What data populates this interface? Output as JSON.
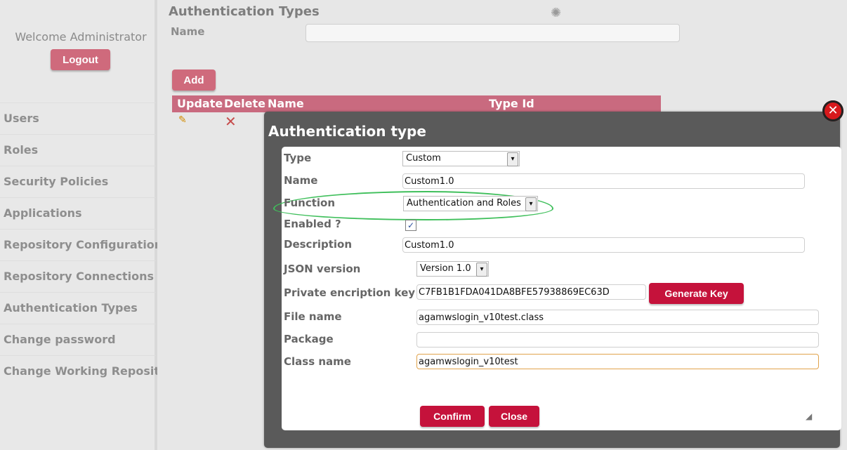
{
  "sidebar": {
    "welcome": "Welcome Administrator",
    "logout": "Logout",
    "items": [
      {
        "label": "Users"
      },
      {
        "label": "Roles"
      },
      {
        "label": "Security Policies"
      },
      {
        "label": "Applications"
      },
      {
        "label": "Repository Configuration"
      },
      {
        "label": "Repository Connections"
      },
      {
        "label": "Authentication Types"
      },
      {
        "label": "Change password"
      },
      {
        "label": "Change Working Repository"
      }
    ]
  },
  "page": {
    "title": "Authentication Types",
    "name_label": "Name",
    "add": "Add",
    "spinner_icon": "loading-spinner",
    "table": {
      "headers": [
        "Update",
        "Delete",
        "Name",
        "Type Id"
      ]
    }
  },
  "modal": {
    "title": "Authentication type",
    "fields": {
      "type_label": "Type",
      "type_value": "Custom",
      "name_label": "Name",
      "name_value": "Custom1.0",
      "function_label": "Function",
      "function_value": "Authentication and Roles",
      "enabled_label": "Enabled ?",
      "description_label": "Description",
      "description_value": "Custom1.0",
      "json_label": "JSON version",
      "json_value": "Version 1.0",
      "key_label": "Private encription key",
      "key_value": "C7FB1B1FDA041DA8BFE57938869EC63D",
      "generate": "Generate Key",
      "file_label": "File name",
      "file_value": "agamwslogin_v10test.class",
      "package_label": "Package",
      "package_value": "",
      "class_label": "Class name",
      "class_value": "agamwslogin_v10test"
    },
    "buttons": {
      "confirm": "Confirm",
      "close": "Close"
    }
  }
}
